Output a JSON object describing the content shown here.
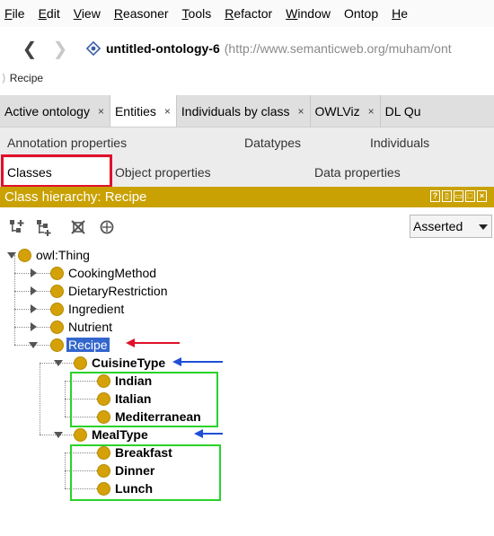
{
  "menubar": {
    "items": [
      {
        "label": "File",
        "first": "F",
        "rest": "ile"
      },
      {
        "label": "Edit",
        "first": "E",
        "rest": "dit"
      },
      {
        "label": "View",
        "first": "V",
        "rest": "iew"
      },
      {
        "label": "Reasoner",
        "first": "R",
        "rest": "easoner"
      },
      {
        "label": "Tools",
        "first": "T",
        "rest": "ools"
      },
      {
        "label": "Refactor",
        "first": "R",
        "rest": "efactor"
      },
      {
        "label": "Window",
        "first": "W",
        "rest": "indow"
      },
      {
        "label": "Ontop",
        "first": "",
        "rest": "Ontop"
      },
      {
        "label": "He",
        "first": "H",
        "rest": "e"
      }
    ]
  },
  "navigation": {
    "back_icon": "back-arrow-icon",
    "forward_icon": "forward-arrow-icon",
    "ontology_name": "untitled-ontology-6",
    "ontology_iri": "(http://www.semanticweb.org/muham/ont",
    "breadcrumb": "Recipe"
  },
  "tabs": [
    {
      "label": "Active ontology",
      "close": "×"
    },
    {
      "label": "Entities",
      "close": "×",
      "active": true
    },
    {
      "label": "Individuals by class",
      "close": "×"
    },
    {
      "label": "OWLViz",
      "close": "×"
    },
    {
      "label": "DL Qu",
      "close": ""
    }
  ],
  "subtabs": {
    "annotation_properties": "Annotation properties",
    "datatypes": "Datatypes",
    "individuals": "Individuals",
    "classes": "Classes",
    "object_properties": "Object properties",
    "data_properties": "Data properties"
  },
  "view": {
    "title": "Class hierarchy: Recipe",
    "controls": [
      "?",
      "▯",
      "▭",
      "□",
      "×"
    ],
    "selector_value": "Asserted"
  },
  "tree": {
    "root": "owl:Thing",
    "items": {
      "cooking_method": "CookingMethod",
      "dietary_restriction": "DietaryRestriction",
      "ingredient": "Ingredient",
      "nutrient": "Nutrient",
      "recipe": "Recipe",
      "cuisine_type": "CuisineType",
      "indian": "Indian",
      "italian": "Italian",
      "mediterranean": "Mediterranean",
      "meal_type": "MealType",
      "breakfast": "Breakfast",
      "dinner": "Dinner",
      "lunch": "Lunch"
    }
  },
  "colors": {
    "class_dot": "#d4a108",
    "view_header": "#c9a102",
    "selection": "#3366cc",
    "red_annotation": "#e0102a",
    "blue_annotation": "#1f4fd8",
    "green_annotation": "#2ad22a"
  }
}
